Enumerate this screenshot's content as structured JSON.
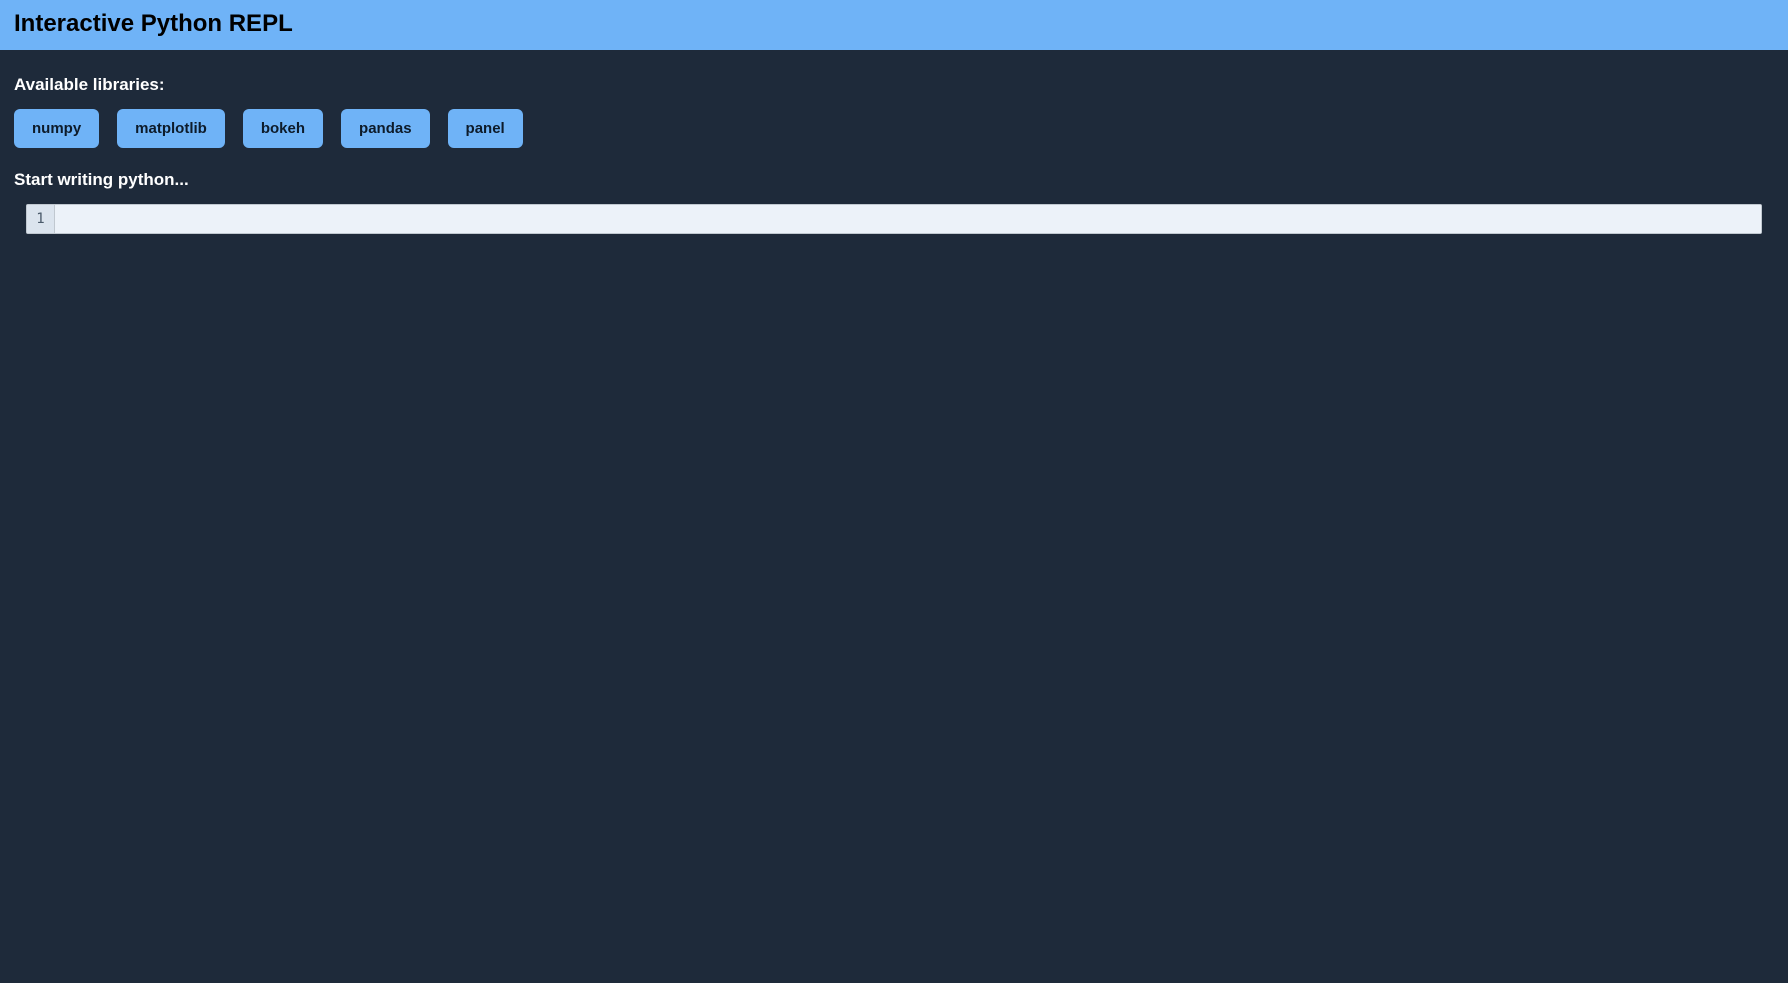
{
  "header": {
    "title": "Interactive Python REPL"
  },
  "libraries": {
    "label": "Available libraries:",
    "items": [
      "numpy",
      "matplotlib",
      "bokeh",
      "pandas",
      "panel"
    ]
  },
  "prompt": {
    "label": "Start writing python..."
  },
  "editor": {
    "line_number": "1",
    "content": ""
  }
}
